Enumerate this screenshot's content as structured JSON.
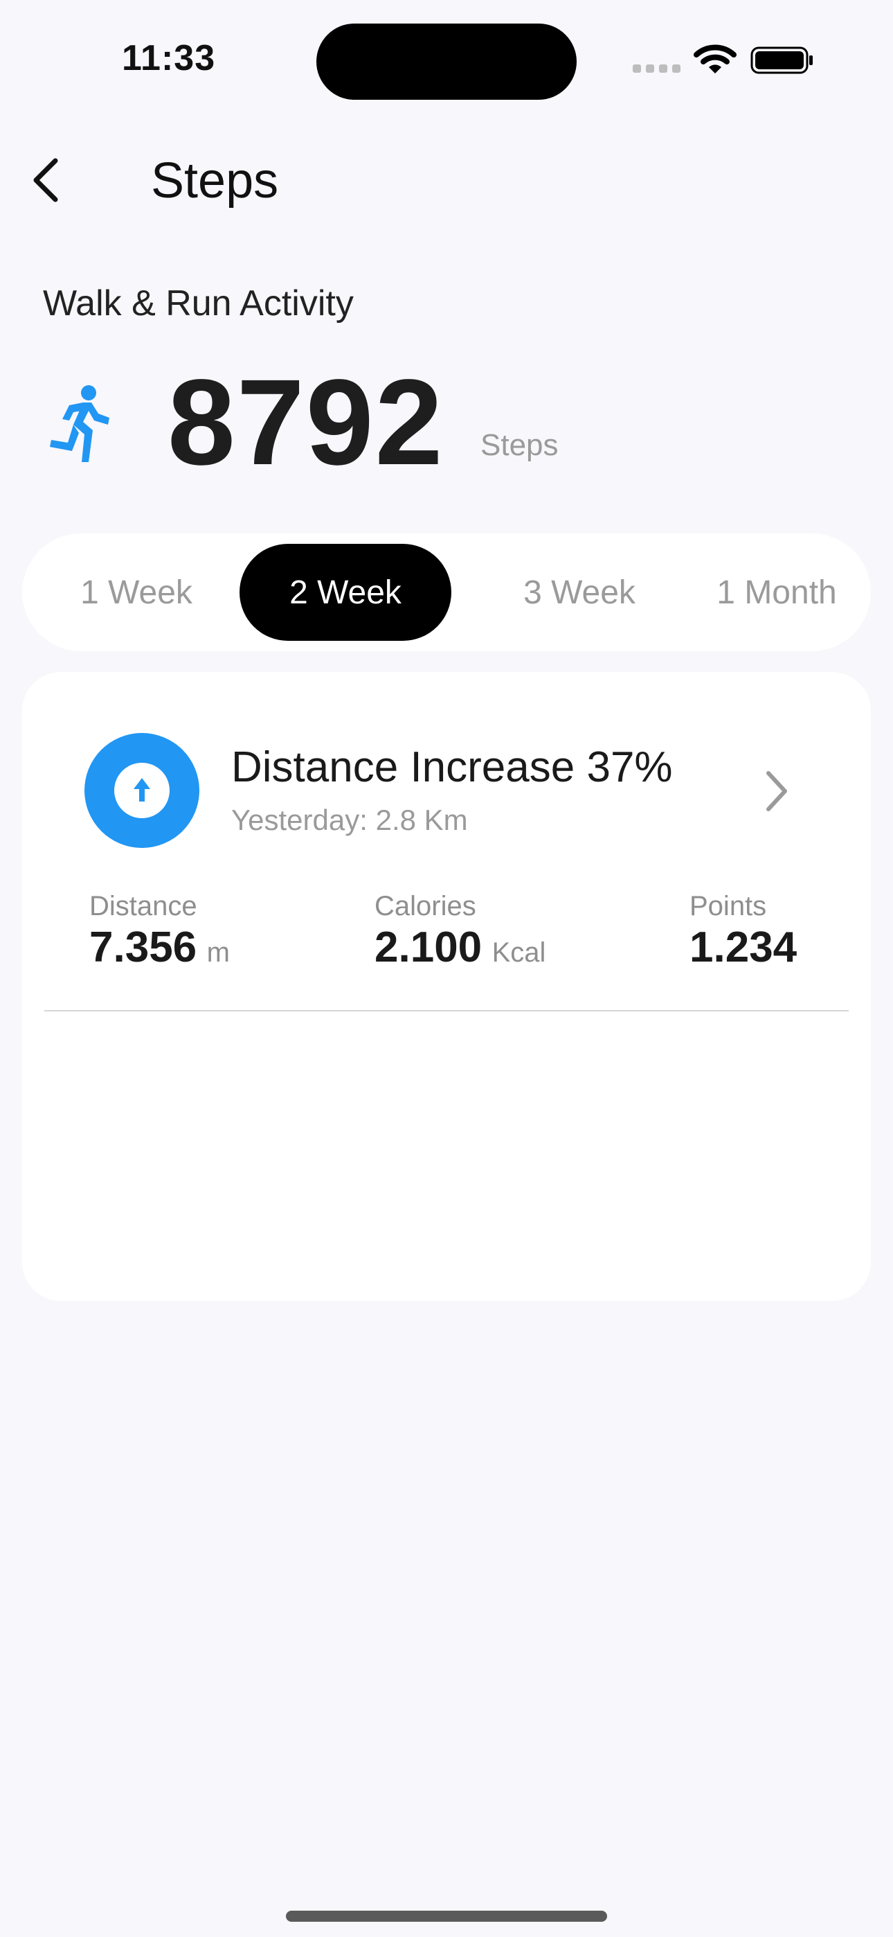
{
  "status_bar": {
    "time": "11:33"
  },
  "header": {
    "title": "Steps",
    "back_icon": "chevron-left-icon"
  },
  "activity": {
    "label": "Walk & Run Activity",
    "icon": "running-person-icon",
    "steps_value": "8792",
    "steps_unit": "Steps"
  },
  "period_tabs": {
    "items": [
      {
        "label": "1 Week"
      },
      {
        "label": "2 Week"
      },
      {
        "label": "3 Week"
      },
      {
        "label": "1 Month"
      }
    ],
    "selected": "2 Week"
  },
  "summary_card": {
    "headline": "Distance Increase 37%",
    "subline": "Yesterday: 2.8 Km",
    "icon": "arrow-up-icon",
    "stats": [
      {
        "label": "Distance",
        "value": "7.356",
        "unit": "m"
      },
      {
        "label": "Calories",
        "value": "2.100",
        "unit": "Kcal"
      },
      {
        "label": "Points",
        "value": "1.234",
        "unit": ""
      }
    ]
  },
  "colors": {
    "accent": "#2196F3",
    "background": "#F7F7FC",
    "active_tab": "#000000",
    "muted_text": "#9A9A9A"
  }
}
